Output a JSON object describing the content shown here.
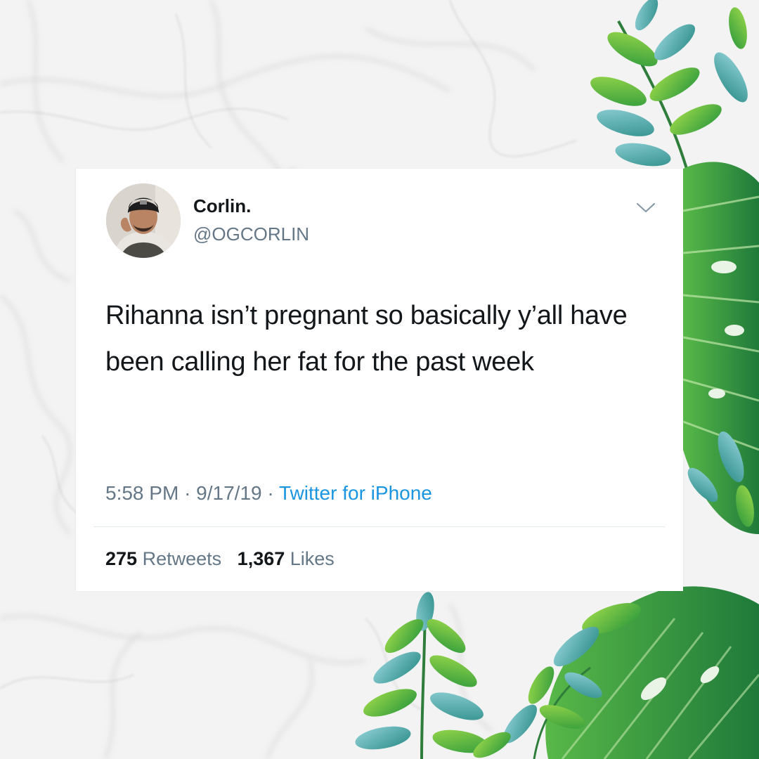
{
  "tweet": {
    "display_name": "Corlin.",
    "handle": "@OGCORLIN",
    "text": "Rihanna isn’t pregnant so basically y’all have been calling her fat for the past week",
    "time": "5:58 PM",
    "separator": "·",
    "date": "9/17/19",
    "source": "Twitter for iPhone",
    "retweets_count": "275",
    "retweets_label": "Retweets",
    "likes_count": "1,367",
    "likes_label": "Likes"
  },
  "icons": {
    "menu": "chevron-down-icon",
    "avatar": "profile-photo"
  },
  "colors": {
    "text": "#14171a",
    "secondary": "#657786",
    "link": "#1b95e0",
    "divider": "#e1e8ed",
    "card": "#ffffff"
  }
}
